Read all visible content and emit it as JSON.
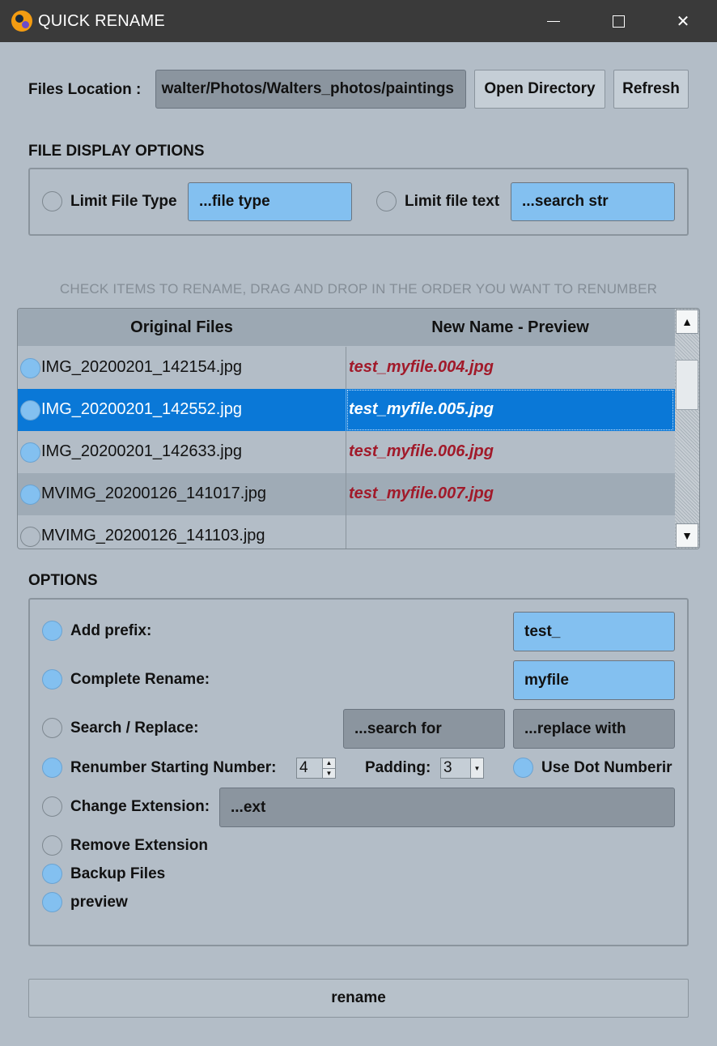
{
  "window": {
    "title": "QUICK RENAME",
    "minimize_glyph": "",
    "maximize_glyph": "",
    "close_glyph": "✕"
  },
  "location": {
    "label": "Files Location :",
    "path": "walter/Photos/Walters_photos/paintings",
    "open_button": "Open Directory",
    "refresh_button": "Refresh"
  },
  "display_options": {
    "heading": "FILE DISPLAY OPTIONS",
    "limit_type_label": "Limit File Type",
    "limit_type_value": "...file type",
    "limit_text_label": "Limit file text",
    "limit_text_value": "...search str"
  },
  "hint": "CHECK ITEMS TO RENAME, DRAG AND DROP IN THE ORDER YOU WANT TO RENUMBER",
  "file_table": {
    "columns": [
      "Original Files",
      "New Name - Preview"
    ],
    "rows": [
      {
        "original": "IMG_20200201_142154.jpg",
        "preview": "test_myfile.004.jpg",
        "checked": true,
        "selected": false,
        "alt": false
      },
      {
        "original": "IMG_20200201_142552.jpg",
        "preview": "test_myfile.005.jpg",
        "checked": true,
        "selected": true,
        "alt": false
      },
      {
        "original": "IMG_20200201_142633.jpg",
        "preview": "test_myfile.006.jpg",
        "checked": true,
        "selected": false,
        "alt": false
      },
      {
        "original": "MVIMG_20200126_141017.jpg",
        "preview": "test_myfile.007.jpg",
        "checked": true,
        "selected": false,
        "alt": true
      },
      {
        "original": "MVIMG_20200126_141103.jpg",
        "preview": "",
        "checked": false,
        "selected": false,
        "alt": false
      }
    ],
    "scroll_up_glyph": "▲",
    "scroll_down_glyph": "▼"
  },
  "options": {
    "heading": "OPTIONS",
    "add_prefix": {
      "label": "Add prefix:",
      "checked": true,
      "value": "test_"
    },
    "complete_rename": {
      "label": "Complete Rename:",
      "checked": true,
      "value": "myfile"
    },
    "search_replace": {
      "label": "Search / Replace:",
      "checked": false,
      "search": "...search for",
      "replace": "...replace with"
    },
    "renumber": {
      "label": "Renumber  Starting Number:",
      "checked": true,
      "start": "4",
      "padding_label": "Padding:",
      "padding": "3",
      "dot_label": "Use Dot Numberir",
      "dot_checked": true
    },
    "change_extension": {
      "label": "Change Extension:",
      "checked": false,
      "value": "...ext"
    },
    "remove_extension": {
      "label": "Remove Extension",
      "checked": false
    },
    "backup_files": {
      "label": "Backup Files",
      "checked": true
    },
    "preview": {
      "label": "preview",
      "checked": true
    }
  },
  "rename_button": "rename",
  "colors": {
    "accent": "#83c0f0",
    "selection": "#0a78d7",
    "preview_text": "#a11a2a",
    "background": "#b3bdc7",
    "titlebar": "#3a3a3a"
  }
}
